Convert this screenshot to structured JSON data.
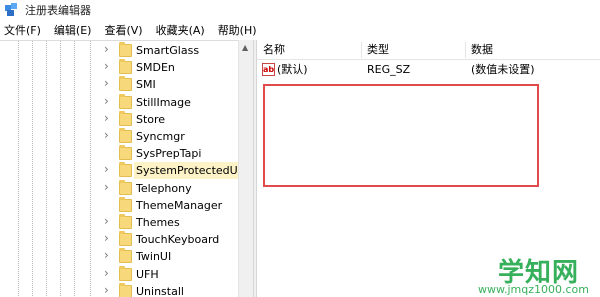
{
  "window": {
    "title": "注册表编辑器",
    "icon": "regedit-icon"
  },
  "menu": [
    "文件(F)",
    "编辑(E)",
    "查看(V)",
    "收藏夹(A)",
    "帮助(H)"
  ],
  "tree": {
    "items": [
      {
        "label": "SmartGlass",
        "expandable": true,
        "selected": false
      },
      {
        "label": "SMDEn",
        "expandable": true,
        "selected": false
      },
      {
        "label": "SMI",
        "expandable": true,
        "selected": false
      },
      {
        "label": "StillImage",
        "expandable": true,
        "selected": false
      },
      {
        "label": "Store",
        "expandable": true,
        "selected": false
      },
      {
        "label": "Syncmgr",
        "expandable": true,
        "selected": false
      },
      {
        "label": "SysPrepTapi",
        "expandable": false,
        "selected": false
      },
      {
        "label": "SystemProtectedUse",
        "expandable": true,
        "selected": true
      },
      {
        "label": "Telephony",
        "expandable": true,
        "selected": false
      },
      {
        "label": "ThemeManager",
        "expandable": false,
        "selected": false
      },
      {
        "label": "Themes",
        "expandable": true,
        "selected": false
      },
      {
        "label": "TouchKeyboard",
        "expandable": true,
        "selected": false
      },
      {
        "label": "TwinUI",
        "expandable": true,
        "selected": false
      },
      {
        "label": "UFH",
        "expandable": true,
        "selected": false
      },
      {
        "label": "Uninstall",
        "expandable": true,
        "selected": false
      }
    ]
  },
  "list": {
    "columns": [
      "名称",
      "类型",
      "数据"
    ],
    "rows": [
      {
        "icon": "ab",
        "name": "(默认)",
        "type": "REG_SZ",
        "data": "(数值未设置)"
      }
    ]
  },
  "watermark": {
    "main": "学知网",
    "sub": "www.jmqz1000.com"
  },
  "colors": {
    "highlight": "#e14b4b",
    "folder": "#f7d87b",
    "selected": "#fdf3c7",
    "watermark": "#37b05c"
  }
}
